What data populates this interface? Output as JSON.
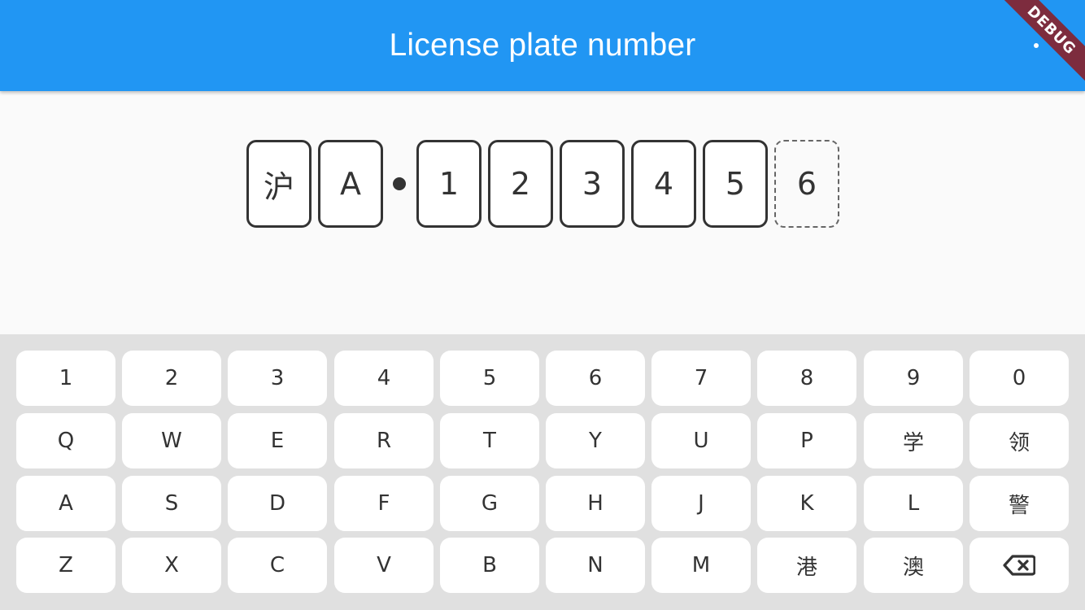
{
  "app_bar": {
    "title": "License plate number",
    "color": "#2196f3",
    "debug_banner": "DEBUG"
  },
  "plate": {
    "province": "沪",
    "letter": "A",
    "separator": "•",
    "digits": [
      "1",
      "2",
      "3",
      "4",
      "5"
    ],
    "next": "6"
  },
  "keyboard": {
    "rows": [
      [
        "1",
        "2",
        "3",
        "4",
        "5",
        "6",
        "7",
        "8",
        "9",
        "0"
      ],
      [
        "Q",
        "W",
        "E",
        "R",
        "T",
        "Y",
        "U",
        "P",
        "学",
        "领"
      ],
      [
        "A",
        "S",
        "D",
        "F",
        "G",
        "H",
        "J",
        "K",
        "L",
        "警"
      ],
      [
        "Z",
        "X",
        "C",
        "V",
        "B",
        "N",
        "M",
        "港",
        "澳"
      ]
    ],
    "backspace_icon": "backspace-icon"
  }
}
